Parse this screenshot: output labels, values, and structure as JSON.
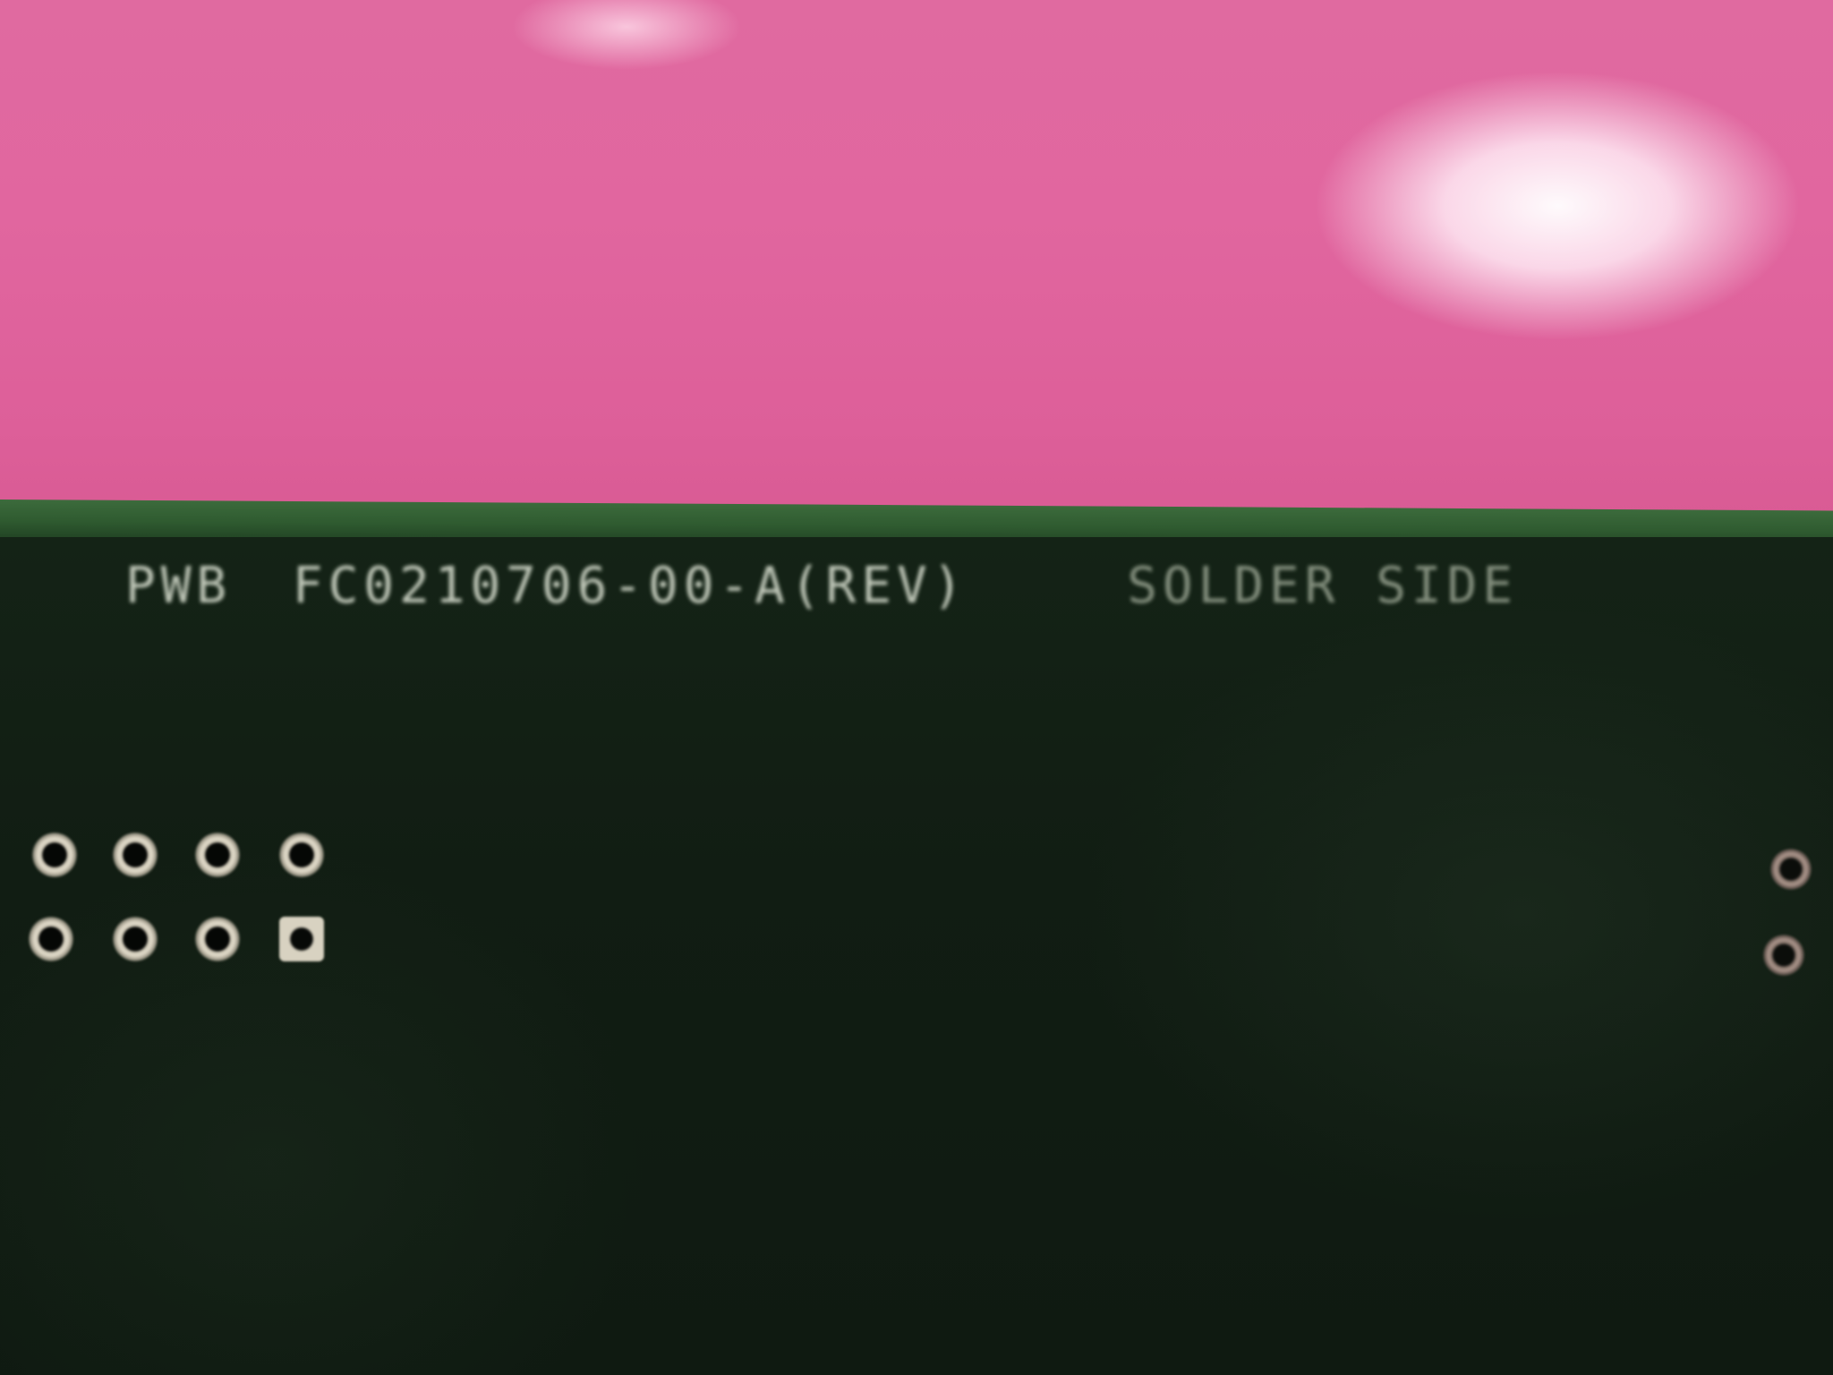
{
  "photo": {
    "subject": "PCB solder side",
    "background_color": "#e1669f",
    "board_color": "#111d13",
    "board_edge_color": "#2f5b30",
    "silkscreen_color": "#cfd6c7"
  },
  "silkscreen": {
    "line_prefix": "PWB",
    "part_number": "FC0210706-00-A(REV)",
    "side_label": "SOLDER SIDE"
  },
  "pads": {
    "left_group_rows": 2,
    "left_group_cols": 4,
    "square_pad_position": "bottom-right of left group",
    "right_edge_pads": 2
  }
}
